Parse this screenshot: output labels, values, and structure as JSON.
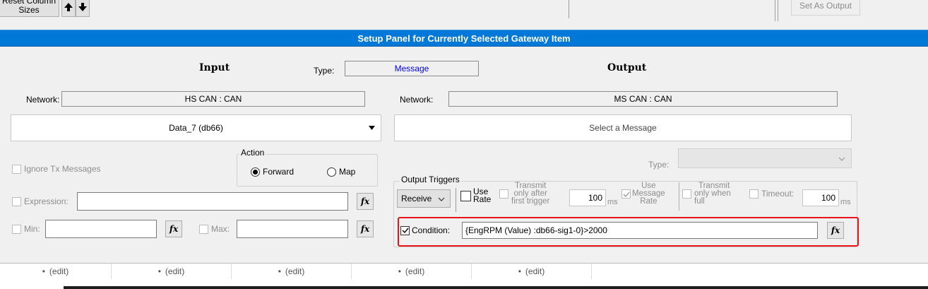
{
  "toolbar": {
    "reset_columns_label_line1": "Reset Column",
    "reset_columns_label_line2": "Sizes",
    "set_as_output_label": "Set As Output"
  },
  "panel": {
    "header_title": "Setup Panel for Currently Selected Gateway Item",
    "input_heading": "Input",
    "output_heading": "Output",
    "type_label": "Type:",
    "type_value": "Message"
  },
  "input": {
    "network_label": "Network:",
    "network_value": "HS CAN : CAN",
    "message_value": "Data_7 (db66)",
    "action_label": "Action",
    "forward_label": "Forward",
    "map_label": "Map",
    "ignore_tx_label": "Ignore Tx Messages",
    "expression_label": "Expression:",
    "expression_value": "",
    "min_label": "Min:",
    "min_value": "",
    "max_label": "Max:",
    "max_value": "",
    "fx_label": "fx"
  },
  "output": {
    "network_label": "Network:",
    "network_value": "MS CAN : CAN",
    "message_placeholder": "Select a Message",
    "type_label": "Type:",
    "triggers_label": "Output Triggers",
    "trigger_select_value": "Receive",
    "use_rate_line1": "Use",
    "use_rate_line2": "Rate",
    "transmit_after_line1": "Transmit",
    "transmit_after_line2": "only after",
    "transmit_after_line3": "first trigger",
    "rate_value": "100",
    "ms_label": "ms",
    "use_msg_rate_line1": "Use",
    "use_msg_rate_line2": "Message",
    "use_msg_rate_line3": "Rate",
    "transmit_full_line1": "Transmit",
    "transmit_full_line2": "only when",
    "transmit_full_line3": "full",
    "timeout_label": "Timeout:",
    "timeout_value": "100",
    "condition_label": "Condition:",
    "condition_value": "{EngRPM (Value) :db66-sig1-0}>2000"
  },
  "footer": {
    "cells": [
      "(edit)",
      "(edit)",
      "(edit)",
      "(edit)",
      "(edit)"
    ]
  },
  "colors": {
    "header_blue": "#0078d7",
    "highlight_red": "#e8141a",
    "link_blue": "#0000ff"
  }
}
